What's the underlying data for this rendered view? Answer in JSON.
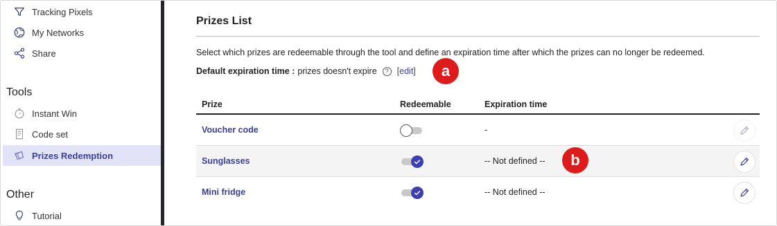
{
  "sidebar": {
    "items_top": [
      {
        "label": "Tracking Pixels",
        "icon": "filter-icon"
      },
      {
        "label": "My Networks",
        "icon": "globe-icon"
      },
      {
        "label": "Share",
        "icon": "share-icon"
      }
    ],
    "tools_heading": "Tools",
    "tools": [
      {
        "label": "Instant Win",
        "icon": "stopwatch-icon"
      },
      {
        "label": "Code set",
        "icon": "document-icon"
      },
      {
        "label": "Prizes Redemption",
        "icon": "gift-icon",
        "active": true
      }
    ],
    "other_heading": "Other",
    "other": [
      {
        "label": "Tutorial",
        "icon": "lightbulb-icon"
      }
    ]
  },
  "main": {
    "title": "Prizes List",
    "description": "Select which prizes are redeemable through the tool and define an expiration time after which the prizes can no longer be redeemed.",
    "default_label": "Default expiration time :",
    "default_value": "prizes doesn't expire",
    "help_glyph": "?",
    "edit_open": "[",
    "edit_link": "edit",
    "edit_close": "]",
    "marker_a": "a",
    "marker_b": "b"
  },
  "table": {
    "headers": {
      "prize": "Prize",
      "redeemable": "Redeemable",
      "expiration": "Expiration time"
    },
    "rows": [
      {
        "prize": "Voucher code",
        "redeemable": false,
        "expiration": "-"
      },
      {
        "prize": "Sunglasses",
        "redeemable": true,
        "expiration": "-- Not defined --"
      },
      {
        "prize": "Mini fridge",
        "redeemable": true,
        "expiration": "-- Not defined --"
      }
    ]
  },
  "colors": {
    "accent": "#3b3fb0",
    "link": "#3b3f9c",
    "marker": "#dd1b1b",
    "active_bg": "#e3e3f7"
  }
}
